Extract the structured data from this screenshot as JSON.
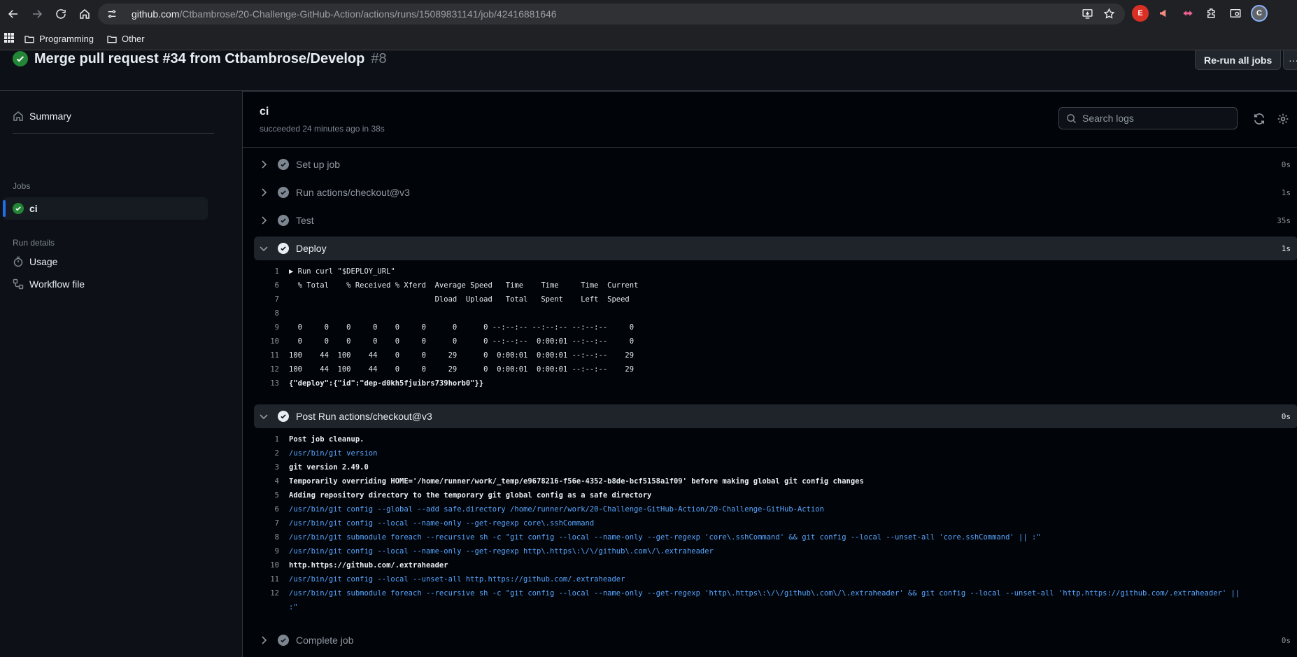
{
  "browser": {
    "url_host": "github.com",
    "url_path": "/Ctbambrose/20-Challenge-GitHub-Action/actions/runs/15089831141/job/42416881646",
    "bookmarks": [
      "Programming",
      "Other"
    ],
    "ext_letter": "E",
    "avatar_letter": "C"
  },
  "run": {
    "title": "Merge pull request #34 from Ctbambrose/Develop",
    "number": "#8",
    "rerun_label": "Re-run all jobs",
    "more_label": "···"
  },
  "sidebar": {
    "summary": "Summary",
    "jobs_heading": "Jobs",
    "job": "ci",
    "run_details_heading": "Run details",
    "usage": "Usage",
    "workflow_file": "Workflow file"
  },
  "job": {
    "name": "ci",
    "status": "succeeded 24 minutes ago in 38s",
    "search_placeholder": "Search logs"
  },
  "steps": [
    {
      "name": "Set up job",
      "duration": "0s"
    },
    {
      "name": "Run actions/checkout@v3",
      "duration": "1s"
    },
    {
      "name": "Test",
      "duration": "35s"
    },
    {
      "name": "Deploy",
      "duration": "1s"
    },
    {
      "name": "Post Run actions/checkout@v3",
      "duration": "0s"
    },
    {
      "name": "Complete job",
      "duration": "0s"
    }
  ],
  "deploy_log": [
    {
      "n": "1",
      "t": "▶ Run curl \"$DEPLOY_URL\""
    },
    {
      "n": "6",
      "t": "  % Total    % Received % Xferd  Average Speed   Time    Time     Time  Current"
    },
    {
      "n": "7",
      "t": "                                 Dload  Upload   Total   Spent    Left  Speed"
    },
    {
      "n": "8",
      "t": ""
    },
    {
      "n": "9",
      "t": "  0     0    0     0    0     0      0      0 --:--:-- --:--:-- --:--:--     0"
    },
    {
      "n": "10",
      "t": "  0     0    0     0    0     0      0      0 --:--:--  0:00:01 --:--:--     0"
    },
    {
      "n": "11",
      "t": "100    44  100    44    0     0     29      0  0:00:01  0:00:01 --:--:--    29"
    },
    {
      "n": "12",
      "t": "100    44  100    44    0     0     29      0  0:00:01  0:00:01 --:--:--    29"
    },
    {
      "n": "13",
      "t": "{\"deploy\":{\"id\":\"dep-d0kh5fjuibrs739horb0\"}}"
    }
  ],
  "post_log": [
    {
      "n": "1",
      "t": "Post job cleanup."
    },
    {
      "n": "2",
      "t": "/usr/bin/git version"
    },
    {
      "n": "3",
      "t": "git version 2.49.0"
    },
    {
      "n": "4",
      "t": "Temporarily overriding HOME='/home/runner/work/_temp/e9678216-f56e-4352-b8de-bcf5158a1f09' before making global git config changes"
    },
    {
      "n": "5",
      "t": "Adding repository directory to the temporary git global config as a safe directory"
    },
    {
      "n": "6",
      "t": "/usr/bin/git config --global --add safe.directory /home/runner/work/20-Challenge-GitHub-Action/20-Challenge-GitHub-Action"
    },
    {
      "n": "7",
      "t": "/usr/bin/git config --local --name-only --get-regexp core\\.sshCommand"
    },
    {
      "n": "8",
      "t": "/usr/bin/git submodule foreach --recursive sh -c \"git config --local --name-only --get-regexp 'core\\.sshCommand' && git config --local --unset-all 'core.sshCommand' || :\""
    },
    {
      "n": "9",
      "t": "/usr/bin/git config --local --name-only --get-regexp http\\.https\\:\\/\\/github\\.com\\/\\.extraheader"
    },
    {
      "n": "10",
      "t": "http.https://github.com/.extraheader"
    },
    {
      "n": "11",
      "t": "/usr/bin/git config --local --unset-all http.https://github.com/.extraheader"
    },
    {
      "n": "12",
      "t": "/usr/bin/git submodule foreach --recursive sh -c \"git config --local --name-only --get-regexp 'http\\.https\\:\\/\\/github\\.com\\/\\.extraheader' && git config --local --unset-all 'http.https://github.com/.extraheader' ||"
    },
    {
      "n": "",
      "t": ":\""
    }
  ],
  "colors": {
    "accent_blue": "#1f6feb",
    "success_green": "#238636",
    "command_blue": "#58a6ff"
  }
}
